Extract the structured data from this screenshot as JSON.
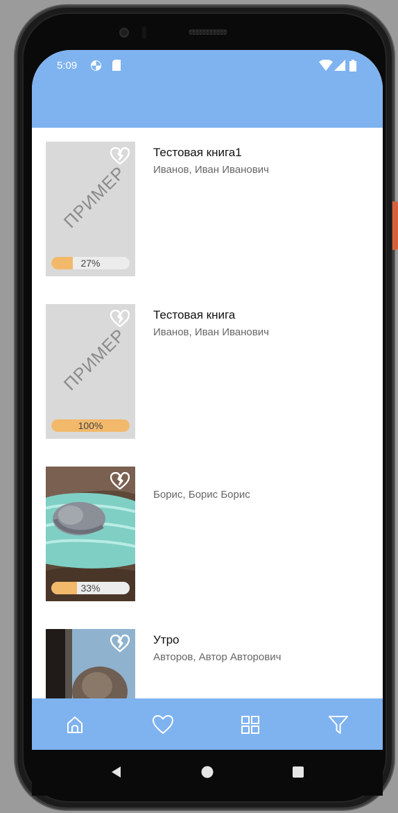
{
  "status_bar": {
    "time": "5:09",
    "icons": [
      "data-saver-icon",
      "sd-card-icon",
      "wifi-icon",
      "signal-icon",
      "battery-icon"
    ]
  },
  "books": [
    {
      "title": "Тестовая книга1",
      "author": "Иванов, Иван Иванович",
      "cover": "placeholder",
      "cover_watermark": "ПРИМЕР",
      "progress": 0.27,
      "progress_label": "27%"
    },
    {
      "title": "Тестовая книга",
      "author": "Иванов, Иван Иванович",
      "cover": "placeholder",
      "cover_watermark": "ПРИМЕР",
      "progress": 1.0,
      "progress_label": "100%"
    },
    {
      "title": "",
      "author": "Борис, Борис Борис",
      "cover": "photo-cat",
      "progress": 0.33,
      "progress_label": "33%"
    },
    {
      "title": "Утро",
      "author": "Авторов, Автор Авторович",
      "cover": "photo-dark",
      "progress": null,
      "progress_label": ""
    }
  ],
  "bottom_nav": [
    "home-icon",
    "heart-icon",
    "grid-icon",
    "filter-icon"
  ],
  "system_nav": [
    "back-icon",
    "home-circle-icon",
    "recents-icon"
  ],
  "colors": {
    "accent": "#7fb3f0",
    "progress_fill": "#f2b96b",
    "cover_placeholder": "#d9d9d9"
  }
}
